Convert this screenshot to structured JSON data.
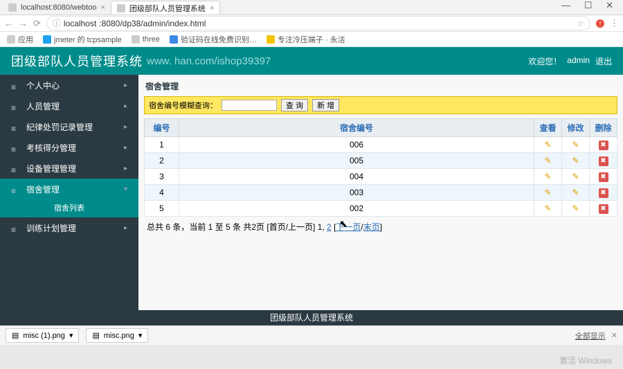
{
  "window": {
    "min": "—",
    "max": "☐",
    "close": "✕"
  },
  "tabs": {
    "t0": {
      "label": "localhost:8080/webtoo"
    },
    "t1": {
      "label": "团级部队人员管理系统"
    }
  },
  "addr": {
    "info_icon": "ⓘ",
    "url_host": "localhost",
    "url_rest": ":8080/dp38/admin/index.html"
  },
  "bookmarks": {
    "apps": "应用",
    "b0": "jmeter 的 tcpsample",
    "b1": "three",
    "b2": "验证码在线免费识别…",
    "b3": "专注冷压端子 · 永洁"
  },
  "banner": {
    "title": "团级部队人员管理系统",
    "sub": "www.   han.com/ishop39397",
    "welcome": "欢迎您！",
    "user": "admin",
    "logout": "退出"
  },
  "sidebar": {
    "items": [
      {
        "label": "个人中心"
      },
      {
        "label": "人员管理"
      },
      {
        "label": "纪律处罚记录管理"
      },
      {
        "label": "考核得分管理"
      },
      {
        "label": "设备管理管理"
      },
      {
        "label": "宿舍管理"
      },
      {
        "label": "训练计划管理"
      }
    ],
    "sub_label": "宿舍列表"
  },
  "main": {
    "crumb": "宿舍管理",
    "filter_label": "宿舍编号模糊查询：",
    "search_btn": "查 询",
    "add_btn": "新 增",
    "search_value": ""
  },
  "table": {
    "headers": {
      "idx": "编号",
      "code": "宿舍编号",
      "view": "查看",
      "edit": "修改",
      "del": "删除"
    },
    "rows": [
      {
        "idx": "1",
        "code": "006"
      },
      {
        "idx": "2",
        "code": "005"
      },
      {
        "idx": "3",
        "code": "004"
      },
      {
        "idx": "4",
        "code": "003"
      },
      {
        "idx": "5",
        "code": "002"
      }
    ]
  },
  "pager": {
    "prefix": "总共 6 条，当前 1 至 5 条 共2页  [首页/上一页] 1, ",
    "p2": "2",
    "mid": " [",
    "next": "下一页",
    "sep": "/",
    "last": "末页",
    "suffix": "]"
  },
  "footer": {
    "text": "团级部队人员管理系统"
  },
  "downloads": {
    "d0": "misc (1).png",
    "d1": "misc.png",
    "showall": "全部显示",
    "close": "✕"
  },
  "watermark": "激活 Windows",
  "icons": {
    "pencil": "✎",
    "del": "✖",
    "file": "▤",
    "chev_down": "▾",
    "chev_right": "▸"
  }
}
